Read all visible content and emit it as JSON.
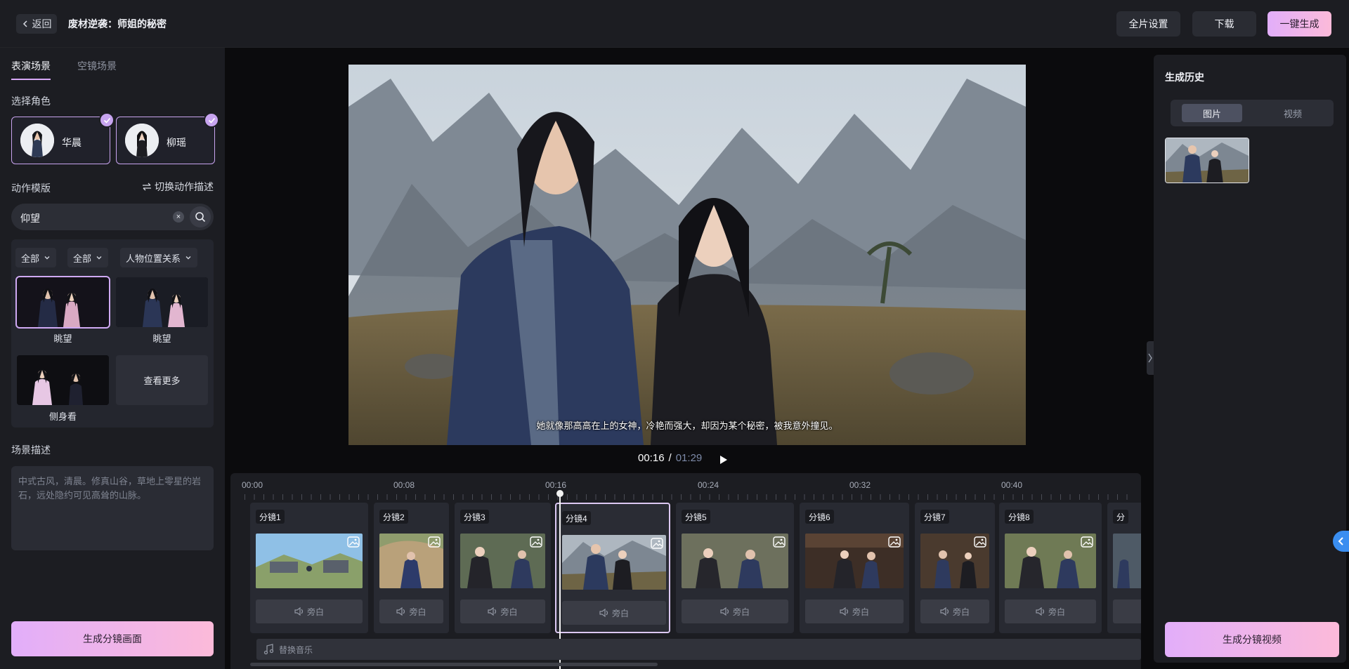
{
  "topbar": {
    "back_label": "返回",
    "project_title": "废材逆袭：师姐的秘密",
    "full_settings": "全片设置",
    "download": "下载",
    "one_click_generate": "一键生成"
  },
  "left": {
    "tabs": [
      "表演场景",
      "空镜场景"
    ],
    "active_tab": "表演场景",
    "select_role_label": "选择角色",
    "roles": [
      {
        "name": "华晨",
        "selected": true
      },
      {
        "name": "柳瑶",
        "selected": true
      }
    ],
    "action_template_label": "动作模版",
    "switch_action_desc": "切换动作描述",
    "search": {
      "value": "仰望",
      "clear_icon": "close-icon",
      "search_icon": "search-icon"
    },
    "filters": [
      "全部",
      "全部",
      "人物位置关系"
    ],
    "actions": [
      {
        "caption": "眺望",
        "selected": true
      },
      {
        "caption": "眺望",
        "selected": false
      },
      {
        "caption": "侧身看",
        "selected": false
      }
    ],
    "view_more": "查看更多",
    "scene_desc_label": "场景描述",
    "scene_desc_text": "中式古风，清晨。修真山谷，草地上零星的岩石，远处隐约可见高耸的山脉。",
    "generate_storyboard_btn": "生成分镜画面"
  },
  "preview": {
    "subtitle": "她就像那高高在上的女神，冷艳而强大，却因为某个秘密，被我意外撞见。",
    "current_time": "00:16",
    "separator": "/",
    "total_time": "01:29"
  },
  "timeline": {
    "ruler": [
      "00:00",
      "00:08",
      "00:16",
      "00:24",
      "00:32",
      "00:40"
    ],
    "playhead_time": "00:16",
    "clips": [
      {
        "label": "分镜1",
        "voice": "旁白",
        "active": false
      },
      {
        "label": "分镜2",
        "voice": "旁白",
        "active": false
      },
      {
        "label": "分镜3",
        "voice": "旁白",
        "active": false
      },
      {
        "label": "分镜4",
        "voice": "旁白",
        "active": true
      },
      {
        "label": "分镜5",
        "voice": "旁白",
        "active": false
      },
      {
        "label": "分镜6",
        "voice": "旁白",
        "active": false
      },
      {
        "label": "分镜7",
        "voice": "旁白",
        "active": false
      },
      {
        "label": "分镜8",
        "voice": "旁白",
        "active": false
      },
      {
        "label": "分",
        "voice": "",
        "active": false
      }
    ],
    "music_label": "替换音乐"
  },
  "right": {
    "history_title": "生成历史",
    "segments": [
      "图片",
      "视频"
    ],
    "active_segment": "图片",
    "generate_video_btn": "生成分镜视频"
  },
  "colors": {
    "accent_gradient_start": "#e2aefa",
    "accent_gradient_end": "#fcbad9",
    "panel_bg": "#1c1d22",
    "canvas_bg": "#0b0b0d",
    "selection_border": "#c8a3ef",
    "floating_button": "#3a8ef0"
  }
}
